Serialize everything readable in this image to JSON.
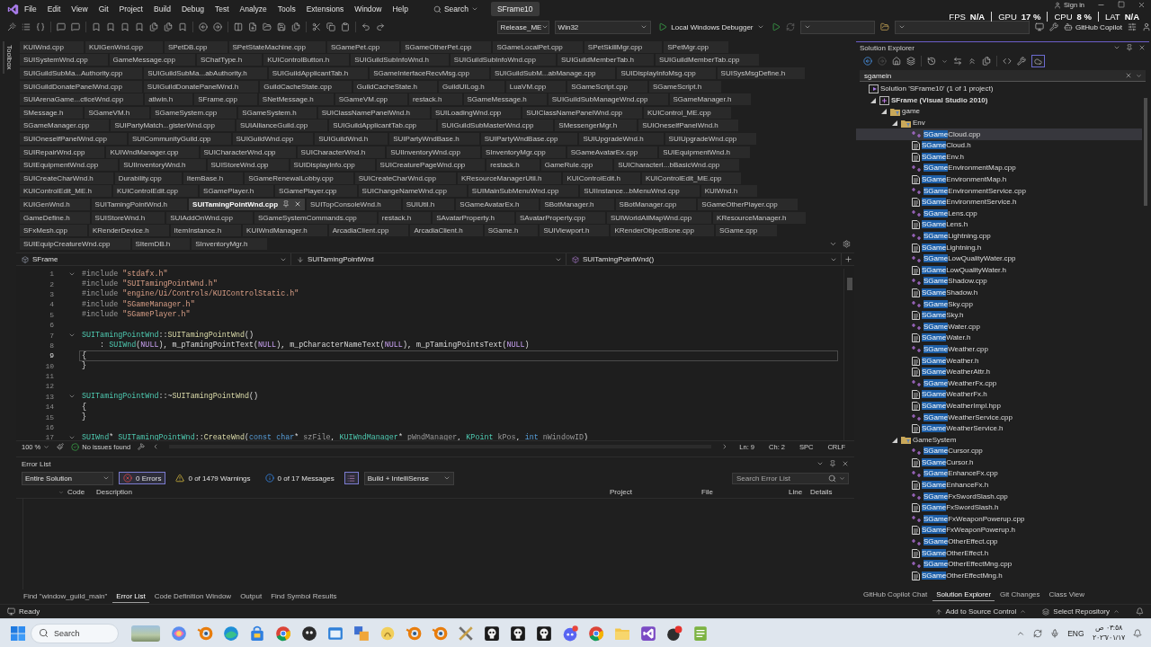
{
  "menu_bar": {
    "items": [
      "File",
      "Edit",
      "View",
      "Git",
      "Project",
      "Build",
      "Debug",
      "Test",
      "Analyze",
      "Tools",
      "Extensions",
      "Window",
      "Help"
    ],
    "search": "Search",
    "solution_name": "SFrame10",
    "sign_in": "Sign in"
  },
  "performance_overlay": [
    {
      "label": "FPS",
      "value": "N/A"
    },
    {
      "label": "GPU",
      "value": "17 %"
    },
    {
      "label": "CPU",
      "value": "8 %"
    },
    {
      "label": "LAT",
      "value": "N/A"
    }
  ],
  "toolbar": {
    "configuration": "Release_ME",
    "platform": "Win32",
    "debugger": "Local Windows Debugger",
    "copilot": "GitHub Copilot"
  },
  "toolbox_label": "Toolbox",
  "document_tabs": [
    [
      {
        "label": "KUIWnd.cpp",
        "selected": false
      },
      {
        "label": "KUIGenWnd.cpp",
        "selected": false
      },
      {
        "label": "SPetDB.cpp",
        "selected": false
      },
      {
        "label": "SPetStateMachine.cpp",
        "selected": false
      },
      {
        "label": "SGamePet.cpp",
        "selected": false
      },
      {
        "label": "SGameOtherPet.cpp",
        "selected": false
      },
      {
        "label": "SGameLocalPet.cpp",
        "selected": false
      },
      {
        "label": "SPetSkillMgr.cpp",
        "selected": false
      },
      {
        "label": "SPetMgr.cpp",
        "selected": false
      }
    ],
    [
      {
        "label": "SUISystemWnd.cpp",
        "selected": false
      },
      {
        "label": "GameMessage.cpp",
        "selected": false
      },
      {
        "label": "SChatType.h",
        "selected": false
      },
      {
        "label": "KUIControlButton.h",
        "selected": false
      },
      {
        "label": "SUIGuildSubInfoWnd.h",
        "selected": false
      },
      {
        "label": "SUIGuildSubInfoWnd.cpp",
        "selected": false
      },
      {
        "label": "SUIGuildMemberTab.h",
        "selected": false
      },
      {
        "label": "SUIGuildMemberTab.cpp",
        "selected": false
      }
    ],
    [
      {
        "label": "SUIGuildSubMa...Authority.cpp",
        "selected": false
      },
      {
        "label": "SUIGuildSubMa...abAuthority.h",
        "selected": false
      },
      {
        "label": "SUIGuildApplicantTab.h",
        "selected": false
      },
      {
        "label": "SGameInterfaceRecvMsg.cpp",
        "selected": false
      },
      {
        "label": "SUIGuildSubM...abManage.cpp",
        "selected": false
      },
      {
        "label": "SUIDisplayInfoMsg.cpp",
        "selected": false
      },
      {
        "label": "SUISysMsgDefine.h",
        "selected": false
      }
    ],
    [
      {
        "label": "SUIGuildDonatePanelWnd.cpp",
        "selected": false
      },
      {
        "label": "SUIGuildDonatePanelWnd.h",
        "selected": false
      },
      {
        "label": "GuildCacheState.cpp",
        "selected": false
      },
      {
        "label": "GuildCacheState.h",
        "selected": false
      },
      {
        "label": "GuildUILog.h",
        "selected": false
      },
      {
        "label": "LuaVM.cpp",
        "selected": false
      },
      {
        "label": "SGameScript.cpp",
        "selected": false
      },
      {
        "label": "SGameScript.h",
        "selected": false
      }
    ],
    [
      {
        "label": "SUIArenaGame...cticeWnd.cpp",
        "selected": false
      },
      {
        "label": "atlwin.h",
        "selected": false
      },
      {
        "label": "SFrame.cpp",
        "selected": false
      },
      {
        "label": "SNetMessage.h",
        "selected": false
      },
      {
        "label": "SGameVM.cpp",
        "selected": false
      },
      {
        "label": "restack.h",
        "selected": false
      },
      {
        "label": "SGameMessage.h",
        "selected": false
      },
      {
        "label": "SUIGuildSubManageWnd.cpp",
        "selected": false
      },
      {
        "label": "SGameManager.h",
        "selected": false
      }
    ],
    [
      {
        "label": "SMessage.h",
        "selected": false
      },
      {
        "label": "SGameVM.h",
        "selected": false
      },
      {
        "label": "SGameSystem.cpp",
        "selected": false
      },
      {
        "label": "SGameSystem.h",
        "selected": false
      },
      {
        "label": "SUIClassNamePanelWnd.h",
        "selected": false
      },
      {
        "label": "SUILoadingWnd.cpp",
        "selected": false
      },
      {
        "label": "SUIClassNamePanelWnd.cpp",
        "selected": false
      },
      {
        "label": "KUIControl_ME.cpp",
        "selected": false
      }
    ],
    [
      {
        "label": "SGameManager.cpp",
        "selected": false
      },
      {
        "label": "SUIPartyMatch...gisterWnd.cpp",
        "selected": false
      },
      {
        "label": "SUIAllianceGuild.cpp",
        "selected": false
      },
      {
        "label": "SUIGuildApplicantTab.cpp",
        "selected": false
      },
      {
        "label": "SUIGuildSubMasterWnd.cpp",
        "selected": false
      },
      {
        "label": "SMessengerMgr.h",
        "selected": false
      },
      {
        "label": "SUIOneselfPanelWnd.h",
        "selected": false
      }
    ],
    [
      {
        "label": "SUIOneselfPanelWnd.cpp",
        "selected": false
      },
      {
        "label": "SUICommunityGuild.cpp",
        "selected": false
      },
      {
        "label": "SUIGuildWnd.cpp",
        "selected": false
      },
      {
        "label": "SUIGuildWnd.h",
        "selected": false
      },
      {
        "label": "SUIPartyWndBase.h",
        "selected": false
      },
      {
        "label": "SUIPartyWndBase.cpp",
        "selected": false
      },
      {
        "label": "SUIUpgradeWnd.h",
        "selected": false
      },
      {
        "label": "SUIUpgradeWnd.cpp",
        "selected": false
      }
    ],
    [
      {
        "label": "SUIRepairWnd.cpp",
        "selected": false
      },
      {
        "label": "KUIWndManager.cpp",
        "selected": false
      },
      {
        "label": "SUICharacterWnd.cpp",
        "selected": false
      },
      {
        "label": "SUICharacterWnd.h",
        "selected": false
      },
      {
        "label": "SUIInventoryWnd.cpp",
        "selected": false
      },
      {
        "label": "SInventoryMgr.cpp",
        "selected": false
      },
      {
        "label": "SGameAvatarEx.cpp",
        "selected": false
      },
      {
        "label": "SUIEquipmentWnd.h",
        "selected": false
      }
    ],
    [
      {
        "label": "SUIEquipmentWnd.cpp",
        "selected": false
      },
      {
        "label": "SUIInventoryWnd.h",
        "selected": false
      },
      {
        "label": "SUIStoreWnd.cpp",
        "selected": false
      },
      {
        "label": "SUIDisplayInfo.cpp",
        "selected": false
      },
      {
        "label": "SUICreaturePageWnd.cpp",
        "selected": false
      },
      {
        "label": "restack.h",
        "selected": false
      },
      {
        "label": "GameRule.cpp",
        "selected": false
      },
      {
        "label": "SUICharacterI...bBasicWnd.cpp",
        "selected": false
      }
    ],
    [
      {
        "label": "SUICreateCharWnd.h",
        "selected": false
      },
      {
        "label": "Durability.cpp",
        "selected": false
      },
      {
        "label": "ItemBase.h",
        "selected": false
      },
      {
        "label": "SGameRenewalLobby.cpp",
        "selected": false
      },
      {
        "label": "SUICreateCharWnd.cpp",
        "selected": false
      },
      {
        "label": "KResourceManagerUtil.h",
        "selected": false
      },
      {
        "label": "KUIControlEdit.h",
        "selected": false
      },
      {
        "label": "KUIControlEdit_ME.cpp",
        "selected": false
      }
    ],
    [
      {
        "label": "KUIControlEdit_ME.h",
        "selected": false
      },
      {
        "label": "KUIControlEdit.cpp",
        "selected": false
      },
      {
        "label": "SGamePlayer.h",
        "selected": false
      },
      {
        "label": "SGamePlayer.cpp",
        "selected": false
      },
      {
        "label": "SUIChangeNameWnd.cpp",
        "selected": false
      },
      {
        "label": "SUIMainSubMenuWnd.cpp",
        "selected": false
      },
      {
        "label": "SUIInstance...bMenuWnd.cpp",
        "selected": false
      },
      {
        "label": "KUIWnd.h",
        "selected": false
      }
    ],
    [
      {
        "label": "KUIGenWnd.h",
        "selected": false
      },
      {
        "label": "SUITamingPointWnd.h",
        "selected": false
      },
      {
        "label": "SUITamingPointWnd.cpp",
        "selected": true
      },
      {
        "label": "SUITopConsoleWnd.h",
        "selected": false
      },
      {
        "label": "SUIUtil.h",
        "selected": false
      },
      {
        "label": "SGameAvatarEx.h",
        "selected": false
      },
      {
        "label": "SBotManager.h",
        "selected": false
      },
      {
        "label": "SBotManager.cpp",
        "selected": false
      },
      {
        "label": "SGameOtherPlayer.cpp",
        "selected": false
      }
    ],
    [
      {
        "label": "GameDefine.h",
        "selected": false
      },
      {
        "label": "SUIStoreWnd.h",
        "selected": false
      },
      {
        "label": "SUIAddOnWnd.cpp",
        "selected": false
      },
      {
        "label": "SGameSystemCommands.cpp",
        "selected": false
      },
      {
        "label": "restack.h",
        "selected": false
      },
      {
        "label": "SAvatarProperty.h",
        "selected": false
      },
      {
        "label": "SAvatarProperty.cpp",
        "selected": false
      },
      {
        "label": "SUIWorldAllMapWnd.cpp",
        "selected": false
      },
      {
        "label": "KResourceManager.h",
        "selected": false
      }
    ],
    [
      {
        "label": "SFxMesh.cpp",
        "selected": false
      },
      {
        "label": "KRenderDevice.h",
        "selected": false
      },
      {
        "label": "ItemInstance.h",
        "selected": false
      },
      {
        "label": "KUIWndManager.h",
        "selected": false
      },
      {
        "label": "ArcadiaClient.cpp",
        "selected": false
      },
      {
        "label": "ArcadiaClient.h",
        "selected": false
      },
      {
        "label": "SGame.h",
        "selected": false
      },
      {
        "label": "SUIViewport.h",
        "selected": false
      },
      {
        "label": "KRenderObjectBone.cpp",
        "selected": false
      },
      {
        "label": "SGame.cpp",
        "selected": false
      }
    ],
    [
      {
        "label": "SUIEquipCreatureWnd.cpp",
        "selected": false
      },
      {
        "label": "SItemDB.h",
        "selected": false
      },
      {
        "label": "SInventoryMgr.h",
        "selected": false
      }
    ]
  ],
  "editor": {
    "project": "SFrame",
    "scope": "SUITamingPointWnd",
    "member": "SUITamingPointWnd()",
    "lines": [
      {
        "number": "1",
        "current": false,
        "foldable": true,
        "tokens": [
          {
            "text": "#include",
            "kind": "preprocessor"
          },
          {
            "text": " \"stdafx.h\"",
            "kind": "string"
          }
        ]
      },
      {
        "number": "2",
        "current": false,
        "foldable": false,
        "tokens": [
          {
            "text": "#include",
            "kind": "preprocessor"
          },
          {
            "text": " \"SUITamingPointWnd.h\"",
            "kind": "string"
          }
        ]
      },
      {
        "number": "3",
        "current": false,
        "foldable": false,
        "tokens": [
          {
            "text": "#include",
            "kind": "preprocessor"
          },
          {
            "text": " \"engine/Ui/Controls/KUIControlStatic.h\"",
            "kind": "string"
          }
        ]
      },
      {
        "number": "4",
        "current": false,
        "foldable": false,
        "tokens": [
          {
            "text": "#include",
            "kind": "preprocessor"
          },
          {
            "text": " \"SGameManager.h\"",
            "kind": "string"
          }
        ]
      },
      {
        "number": "5",
        "current": false,
        "foldable": false,
        "tokens": [
          {
            "text": "#include",
            "kind": "preprocessor"
          },
          {
            "text": " \"SGamePlayer.h\"",
            "kind": "string"
          }
        ]
      },
      {
        "number": "6",
        "current": false,
        "foldable": false
      },
      {
        "number": "7",
        "current": false,
        "foldable": true,
        "tokens": [
          {
            "text": "SUITamingPointWnd",
            "kind": "type"
          },
          {
            "text": "::",
            "kind": "plain"
          },
          {
            "text": "SUITamingPointWnd",
            "kind": "function"
          },
          {
            "text": "()",
            "kind": "plain"
          }
        ]
      },
      {
        "number": "8",
        "current": false,
        "foldable": false,
        "tokens": [
          {
            "text": "    : ",
            "kind": "plain"
          },
          {
            "text": "SUIWnd",
            "kind": "type"
          },
          {
            "text": "(",
            "kind": "plain"
          },
          {
            "text": "NULL",
            "kind": "macro"
          },
          {
            "text": "), ",
            "kind": "plain"
          },
          {
            "text": "m_pTamingPointText",
            "kind": "member"
          },
          {
            "text": "(",
            "kind": "plain"
          },
          {
            "text": "NULL",
            "kind": "macro"
          },
          {
            "text": "), ",
            "kind": "plain"
          },
          {
            "text": "m_pCharacterNameText",
            "kind": "member"
          },
          {
            "text": "(",
            "kind": "plain"
          },
          {
            "text": "NULL",
            "kind": "macro"
          },
          {
            "text": "), ",
            "kind": "plain"
          },
          {
            "text": "m_pTamingPointsText",
            "kind": "member"
          },
          {
            "text": "(",
            "kind": "plain"
          },
          {
            "text": "NULL",
            "kind": "macro"
          },
          {
            "text": ")",
            "kind": "plain"
          }
        ]
      },
      {
        "number": "9",
        "current": true,
        "foldable": false,
        "tokens": [
          {
            "text": "{",
            "kind": "plain"
          }
        ]
      },
      {
        "number": "10",
        "current": false,
        "foldable": false,
        "tokens": [
          {
            "text": "}",
            "kind": "plain"
          }
        ]
      },
      {
        "number": "11",
        "current": false,
        "foldable": false
      },
      {
        "number": "12",
        "current": false,
        "foldable": false
      },
      {
        "number": "13",
        "current": false,
        "foldable": true,
        "tokens": [
          {
            "text": "SUITamingPointWnd",
            "kind": "type"
          },
          {
            "text": "::~",
            "kind": "plain"
          },
          {
            "text": "SUITamingPointWnd",
            "kind": "function"
          },
          {
            "text": "()",
            "kind": "plain"
          }
        ]
      },
      {
        "number": "14",
        "current": false,
        "foldable": false,
        "tokens": [
          {
            "text": "{",
            "kind": "plain"
          }
        ]
      },
      {
        "number": "15",
        "current": false,
        "foldable": false,
        "tokens": [
          {
            "text": "}",
            "kind": "plain"
          }
        ]
      },
      {
        "number": "16",
        "current": false,
        "foldable": false
      },
      {
        "number": "17",
        "current": false,
        "foldable": true,
        "tokens": [
          {
            "text": "SUIWnd",
            "kind": "type"
          },
          {
            "text": "* ",
            "kind": "plain"
          },
          {
            "text": "SUITamingPointWnd",
            "kind": "type"
          },
          {
            "text": "::",
            "kind": "plain"
          },
          {
            "text": "CreateWnd",
            "kind": "function"
          },
          {
            "text": "(",
            "kind": "plain"
          },
          {
            "text": "const",
            "kind": "keyword"
          },
          {
            "text": " char",
            "kind": "keyword"
          },
          {
            "text": "* ",
            "kind": "plain"
          },
          {
            "text": "szFile",
            "kind": "parameter"
          },
          {
            "text": ", ",
            "kind": "plain"
          },
          {
            "text": "KUIWndManager",
            "kind": "type"
          },
          {
            "text": "* ",
            "kind": "plain"
          },
          {
            "text": "pWndManager",
            "kind": "parameter"
          },
          {
            "text": ", ",
            "kind": "plain"
          },
          {
            "text": "KPoint",
            "kind": "type"
          },
          {
            "text": " kPos",
            "kind": "parameter"
          },
          {
            "text": ", ",
            "kind": "plain"
          },
          {
            "text": "int",
            "kind": "keyword"
          },
          {
            "text": " nWindowID",
            "kind": "parameter"
          },
          {
            "text": ")",
            "kind": "plain"
          }
        ]
      }
    ],
    "zoom": "100 %",
    "issues": "No issues found",
    "position": [
      "Ln: 9",
      "Ch: 2",
      "SPC",
      "CRLF"
    ]
  },
  "error_list": {
    "title": "Error List",
    "scope": "Entire Solution",
    "filters": [
      {
        "kind": "error",
        "label": "0 Errors",
        "selected": true
      },
      {
        "kind": "warning",
        "label": "0 of 1479 Warnings",
        "selected": false
      },
      {
        "kind": "message",
        "label": "0 of 17 Messages",
        "selected": false
      }
    ],
    "source": "Build + IntelliSense",
    "search_placeholder": "Search Error List",
    "columns": [
      "Code",
      "Description",
      "Project",
      "File",
      "Line",
      "Details"
    ]
  },
  "bottom_tabs": [
    {
      "label": "Find \"window_guild_main\"",
      "selected": false
    },
    {
      "label": "Error List",
      "selected": true
    },
    {
      "label": "Code Definition Window",
      "selected": false
    },
    {
      "label": "Output",
      "selected": false
    },
    {
      "label": "Find Symbol Results",
      "selected": false
    }
  ],
  "solution_explorer": {
    "title": "Solution Explorer",
    "search": "sgamein",
    "tree": [
      {
        "kind": "solution",
        "label": "Solution 'SFrame10' (1 of 1 project)",
        "selected": false,
        "children": [
          {
            "kind": "project",
            "label": "SFrame (Visual Studio 2010)",
            "expanded": true,
            "selected": false,
            "children": [
              {
                "kind": "folder",
                "label": "game",
                "expanded": true,
                "selected": false,
                "children": [
                  {
                    "kind": "folder",
                    "label": "Env",
                    "expanded": true,
                    "selected": false,
                    "children": [
                      {
                        "kind": "source",
                        "match": "SGame",
                        "label": "Cloud.cpp",
                        "selected": true
                      },
                      {
                        "kind": "header",
                        "match": "SGame",
                        "label": "Cloud.h",
                        "selected": false
                      },
                      {
                        "kind": "header",
                        "match": "SGame",
                        "label": "Env.h",
                        "selected": false
                      },
                      {
                        "kind": "source",
                        "match": "SGame",
                        "label": "EnvironmentMap.cpp",
                        "selected": false
                      },
                      {
                        "kind": "header",
                        "match": "SGame",
                        "label": "EnvironmentMap.h",
                        "selected": false
                      },
                      {
                        "kind": "source",
                        "match": "SGame",
                        "label": "EnvironmentService.cpp",
                        "selected": false
                      },
                      {
                        "kind": "header",
                        "match": "SGame",
                        "label": "EnvironmentService.h",
                        "selected": false
                      },
                      {
                        "kind": "source",
                        "match": "SGame",
                        "label": "Lens.cpp",
                        "selected": false
                      },
                      {
                        "kind": "header",
                        "match": "SGame",
                        "label": "Lens.h",
                        "selected": false
                      },
                      {
                        "kind": "source",
                        "match": "SGame",
                        "label": "Lightning.cpp",
                        "selected": false
                      },
                      {
                        "kind": "header",
                        "match": "SGame",
                        "label": "Lightning.h",
                        "selected": false
                      },
                      {
                        "kind": "source",
                        "match": "SGame",
                        "label": "LowQualityWater.cpp",
                        "selected": false
                      },
                      {
                        "kind": "header",
                        "match": "SGame",
                        "label": "LowQualityWater.h",
                        "selected": false
                      },
                      {
                        "kind": "source",
                        "match": "SGame",
                        "label": "Shadow.cpp",
                        "selected": false
                      },
                      {
                        "kind": "header",
                        "match": "SGame",
                        "label": "Shadow.h",
                        "selected": false
                      },
                      {
                        "kind": "source",
                        "match": "SGame",
                        "label": "Sky.cpp",
                        "selected": false
                      },
                      {
                        "kind": "header",
                        "match": "SGame",
                        "label": "Sky.h",
                        "selected": false
                      },
                      {
                        "kind": "source",
                        "match": "SGame",
                        "label": "Water.cpp",
                        "selected": false
                      },
                      {
                        "kind": "header",
                        "match": "SGame",
                        "label": "Water.h",
                        "selected": false
                      },
                      {
                        "kind": "source",
                        "match": "SGame",
                        "label": "Weather.cpp",
                        "selected": false
                      },
                      {
                        "kind": "header",
                        "match": "SGame",
                        "label": "Weather.h",
                        "selected": false
                      },
                      {
                        "kind": "header",
                        "match": "SGame",
                        "label": "WeatherAttr.h",
                        "selected": false
                      },
                      {
                        "kind": "source",
                        "match": "SGame",
                        "label": "WeatherFx.cpp",
                        "selected": false
                      },
                      {
                        "kind": "header",
                        "match": "SGame",
                        "label": "WeatherFx.h",
                        "selected": false
                      },
                      {
                        "kind": "header",
                        "match": "SGame",
                        "label": "WeatherImpl.hpp",
                        "selected": false
                      },
                      {
                        "kind": "source",
                        "match": "SGame",
                        "label": "WeatherService.cpp",
                        "selected": false
                      },
                      {
                        "kind": "header",
                        "match": "SGame",
                        "label": "WeatherService.h",
                        "selected": false
                      }
                    ]
                  },
                  {
                    "kind": "folder",
                    "label": "GameSystem",
                    "expanded": true,
                    "selected": false,
                    "children": [
                      {
                        "kind": "source",
                        "match": "SGame",
                        "label": "Cursor.cpp",
                        "selected": false
                      },
                      {
                        "kind": "header",
                        "match": "SGame",
                        "label": "Cursor.h",
                        "selected": false
                      },
                      {
                        "kind": "source",
                        "match": "SGame",
                        "label": "EnhanceFx.cpp",
                        "selected": false
                      },
                      {
                        "kind": "header",
                        "match": "SGame",
                        "label": "EnhanceFx.h",
                        "selected": false
                      },
                      {
                        "kind": "source",
                        "match": "SGame",
                        "label": "FxSwordSlash.cpp",
                        "selected": false
                      },
                      {
                        "kind": "header",
                        "match": "SGame",
                        "label": "FxSwordSlash.h",
                        "selected": false
                      },
                      {
                        "kind": "source",
                        "match": "SGame",
                        "label": "FxWeaponPowerup.cpp",
                        "selected": false
                      },
                      {
                        "kind": "header",
                        "match": "SGame",
                        "label": "FxWeaponPowerup.h",
                        "selected": false
                      },
                      {
                        "kind": "source",
                        "match": "SGame",
                        "label": "OtherEffect.cpp",
                        "selected": false
                      },
                      {
                        "kind": "header",
                        "match": "SGame",
                        "label": "OtherEffect.h",
                        "selected": false
                      },
                      {
                        "kind": "source",
                        "match": "SGame",
                        "label": "OtherEffectMng.cpp",
                        "selected": false
                      },
                      {
                        "kind": "header",
                        "match": "SGame",
                        "label": "OtherEffectMng.h",
                        "selected": false
                      }
                    ]
                  }
                ]
              }
            ]
          }
        ]
      }
    ],
    "tabs": [
      {
        "label": "GitHub Copilot Chat",
        "selected": false
      },
      {
        "label": "Solution Explorer",
        "selected": true
      },
      {
        "label": "Git Changes",
        "selected": false
      },
      {
        "label": "Class View",
        "selected": false
      }
    ]
  },
  "status_bar": {
    "status": "Ready",
    "source_control": "Add to Source Control",
    "repository": "Select Repository"
  },
  "taskbar": {
    "search_placeholder": "Search",
    "language": "ENG",
    "time": "٠٣:٥٨ ص",
    "date": "٢٠٢٦/٠١/١٧"
  }
}
